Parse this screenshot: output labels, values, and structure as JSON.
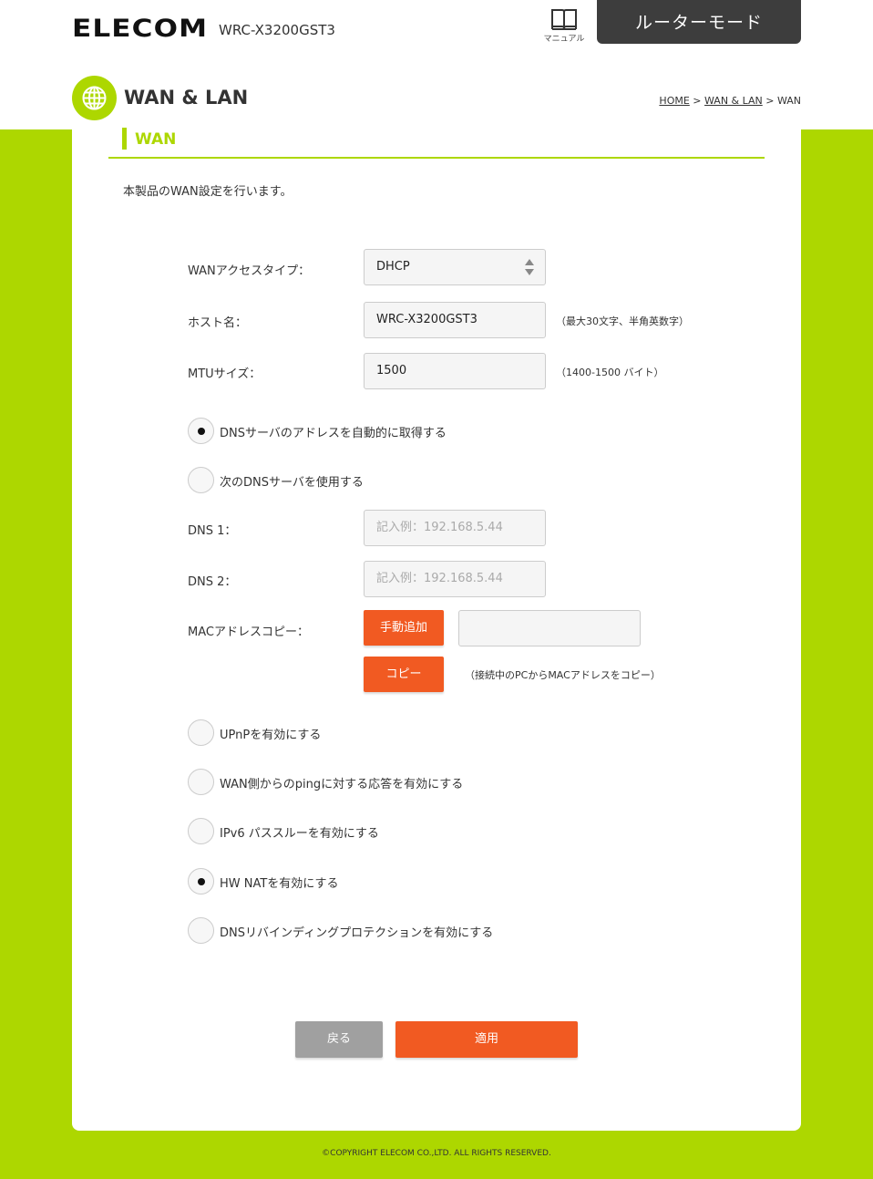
{
  "header": {
    "logo": "ELECOM",
    "model": "WRC-X3200GST3",
    "manual_label": "マニュアル",
    "mode": "ルーターモード"
  },
  "section": {
    "title": "WAN & LAN",
    "breadcrumb": [
      "HOME",
      "WAN & LAN",
      "WAN"
    ],
    "breadcrumb_sep": ">"
  },
  "subsection": {
    "title": "WAN",
    "description": "本製品のWAN設定を行います。"
  },
  "form": {
    "wan_type_label": "WANアクセスタイプ：",
    "wan_type_value": "DHCP",
    "hostname_label": "ホスト名：",
    "hostname_value": "WRC-X3200GST3",
    "hostname_note": "（最大30文字、半角英数字）",
    "mtu_label": "MTUサイズ：",
    "mtu_value": "1500",
    "mtu_note": "（1400-1500 バイト）",
    "dns_auto_label": "DNSサーバのアドレスを自動的に取得する",
    "dns_auto_checked": true,
    "dns_manual_label": "次のDNSサーバを使用する",
    "dns_manual_checked": false,
    "dns1_label": "DNS 1：",
    "dns1_placeholder": "記入例：192.168.5.44",
    "dns2_label": "DNS 2：",
    "dns2_placeholder": "記入例：192.168.5.44",
    "mac_label": "MACアドレスコピー：",
    "mac_manual_button": "手動追加",
    "mac_value": "",
    "mac_copy_button": "コピー",
    "mac_copy_note": "（接続中のPCからMACアドレスをコピー）",
    "upnp_label": "UPnPを有効にする",
    "upnp_checked": false,
    "ping_label": "WAN側からのpingに対する応答を有効にする",
    "ping_checked": false,
    "ipv6_label": "IPv6 パススルーを有効にする",
    "ipv6_checked": false,
    "hwnat_label": "HW NATを有効にする",
    "hwnat_checked": true,
    "rebinding_label": "DNSリバインディングプロテクションを有効にする",
    "rebinding_checked": false
  },
  "actions": {
    "back": "戻る",
    "apply": "適用"
  },
  "footer": {
    "copyright": "©COPYRIGHT ELECOM CO.,LTD. ALL RIGHTS RESERVED."
  },
  "colors": {
    "accent_green": "#add700",
    "button_orange": "#f15a22",
    "button_gray": "#a0a0a0",
    "mode_box": "#3d3d3d"
  }
}
